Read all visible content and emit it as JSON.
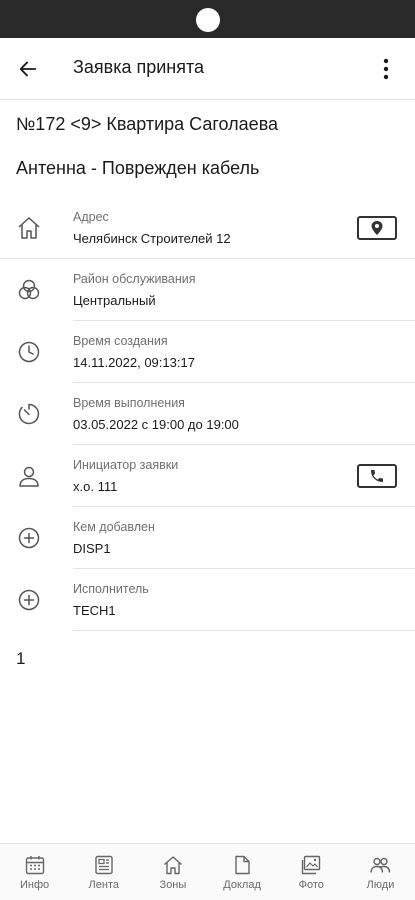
{
  "header": {
    "title": "Заявка принята",
    "back_icon": "arrow-left-icon",
    "menu_icon": "more-vert-icon"
  },
  "request": {
    "title": "№172 <9> Квартира Саголаева",
    "subtitle": "Антенна - Поврежден кабель"
  },
  "details": [
    {
      "icon": "home-icon",
      "label": "Адрес",
      "value": "Челябинск Строителей 12",
      "action_icon": "map-pin-icon"
    },
    {
      "icon": "district-icon",
      "label": "Район обслуживания",
      "value": "Центральный"
    },
    {
      "icon": "clock-icon",
      "label": "Время создания",
      "value": "14.11.2022, 09:13:17"
    },
    {
      "icon": "timer-icon",
      "label": "Время выполнения",
      "value": "03.05.2022 с 19:00 до 19:00"
    },
    {
      "icon": "person-icon",
      "label": "Инициатор заявки",
      "value": "х.о. 111",
      "action_icon": "phone-icon"
    },
    {
      "icon": "add-circle-icon",
      "label": "Кем добавлен",
      "value": "DISP1"
    },
    {
      "icon": "add-circle-icon",
      "label": "Исполнитель",
      "value": "TECH1"
    }
  ],
  "extra_text": "1",
  "bottom_nav": [
    {
      "icon": "calendar-icon",
      "label": "Инфо"
    },
    {
      "icon": "feed-icon",
      "label": "Лента"
    },
    {
      "icon": "zones-icon",
      "label": "Зоны"
    },
    {
      "icon": "document-icon",
      "label": "Доклад"
    },
    {
      "icon": "photo-icon",
      "label": "Фото"
    },
    {
      "icon": "people-icon",
      "label": "Люди"
    }
  ]
}
